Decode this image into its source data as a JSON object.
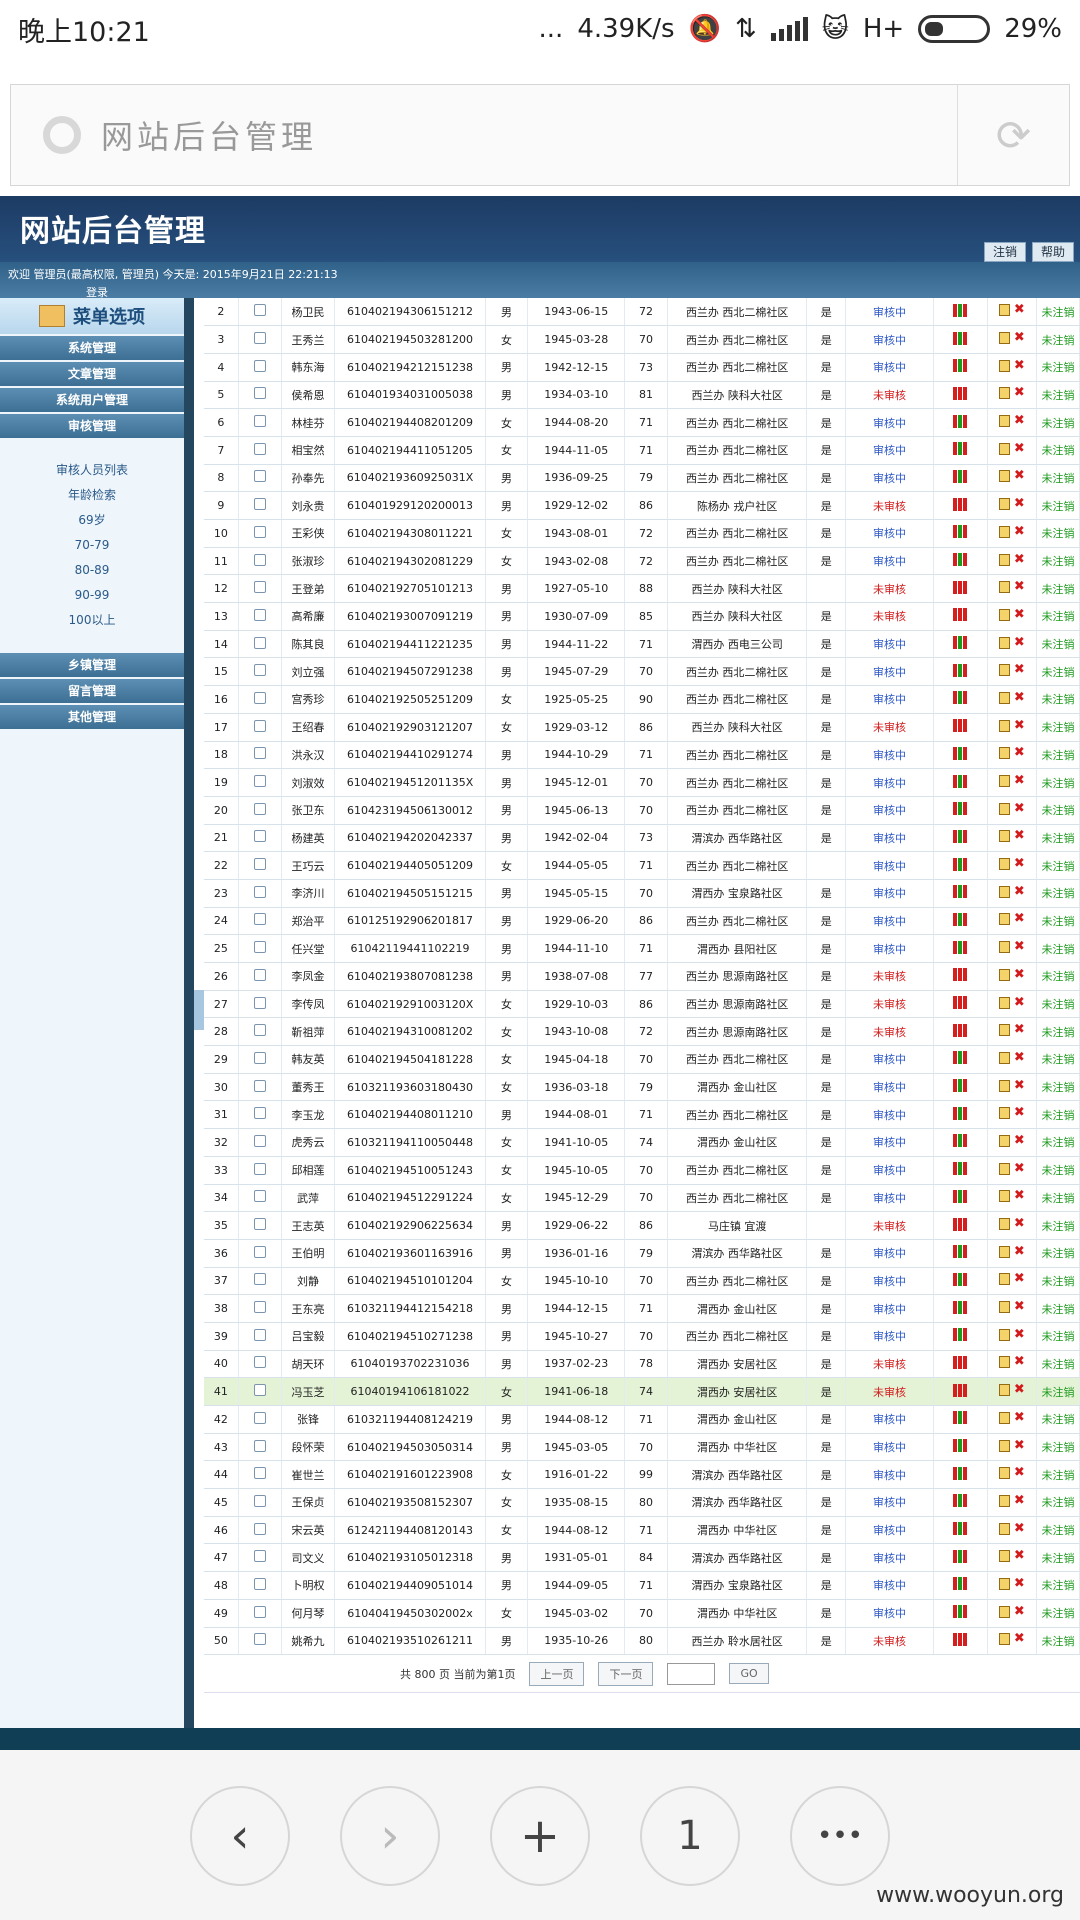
{
  "status_bar": {
    "time": "晚上10:21",
    "dots": "...",
    "speed": "4.39K/s",
    "network": "H+",
    "battery": "29%"
  },
  "browser": {
    "page_title": "网站后台管理"
  },
  "admin": {
    "logo": "网站后台管理",
    "btn_logout": "注销",
    "btn_help": "帮助",
    "welcome": "欢迎 管理员(最高权限, 管理员) 今天是: 2015年9月21日 22:21:13",
    "login_label": "登录"
  },
  "sidebar": {
    "header": "菜单选项",
    "menu": [
      "系统管理",
      "文章管理",
      "系统用户管理",
      "审核管理"
    ],
    "submenu": [
      "审核人员列表",
      "年龄检索",
      "69岁",
      "70-79",
      "80-89",
      "90-99",
      "100以上"
    ],
    "menu2": [
      "乡镇管理",
      "留言管理",
      "其他管理"
    ]
  },
  "table": {
    "rows": [
      {
        "no": "2",
        "name": "杨卫民",
        "id": "610402194306151212",
        "sex": "男",
        "birth": "1943-06-15",
        "age": "72",
        "addr": "西兰办 西北二棉社区",
        "yes": "是",
        "status": "审核中",
        "ok": true,
        "logout": "未注销"
      },
      {
        "no": "3",
        "name": "王秀兰",
        "id": "610402194503281200",
        "sex": "女",
        "birth": "1945-03-28",
        "age": "70",
        "addr": "西兰办 西北二棉社区",
        "yes": "是",
        "status": "审核中",
        "ok": true,
        "logout": "未注销"
      },
      {
        "no": "4",
        "name": "韩东海",
        "id": "610402194212151238",
        "sex": "男",
        "birth": "1942-12-15",
        "age": "73",
        "addr": "西兰办 西北二棉社区",
        "yes": "是",
        "status": "审核中",
        "ok": true,
        "logout": "未注销"
      },
      {
        "no": "5",
        "name": "侯希恩",
        "id": "610401934031005038",
        "sex": "男",
        "birth": "1934-03-10",
        "age": "81",
        "addr": "西兰办 陕科大社区",
        "yes": "是",
        "status": "未审核",
        "ok": false,
        "logout": "未注销"
      },
      {
        "no": "6",
        "name": "林桂芬",
        "id": "610402194408201209",
        "sex": "女",
        "birth": "1944-08-20",
        "age": "71",
        "addr": "西兰办 西北二棉社区",
        "yes": "是",
        "status": "审核中",
        "ok": true,
        "logout": "未注销"
      },
      {
        "no": "7",
        "name": "相宝然",
        "id": "610402194411051205",
        "sex": "女",
        "birth": "1944-11-05",
        "age": "71",
        "addr": "西兰办 西北二棉社区",
        "yes": "是",
        "status": "审核中",
        "ok": true,
        "logout": "未注销"
      },
      {
        "no": "8",
        "name": "孙奉先",
        "id": "61040219360925031X",
        "sex": "男",
        "birth": "1936-09-25",
        "age": "79",
        "addr": "西兰办 西北二棉社区",
        "yes": "是",
        "status": "审核中",
        "ok": true,
        "logout": "未注销"
      },
      {
        "no": "9",
        "name": "刘永贵",
        "id": "610401929120200013",
        "sex": "男",
        "birth": "1929-12-02",
        "age": "86",
        "addr": "陈杨办 戎户社区",
        "yes": "是",
        "status": "未审核",
        "ok": false,
        "logout": "未注销"
      },
      {
        "no": "10",
        "name": "王彩侠",
        "id": "610402194308011221",
        "sex": "女",
        "birth": "1943-08-01",
        "age": "72",
        "addr": "西兰办 西北二棉社区",
        "yes": "是",
        "status": "审核中",
        "ok": true,
        "logout": "未注销"
      },
      {
        "no": "11",
        "name": "张淑珍",
        "id": "610402194302081229",
        "sex": "女",
        "birth": "1943-02-08",
        "age": "72",
        "addr": "西兰办 西北二棉社区",
        "yes": "是",
        "status": "审核中",
        "ok": true,
        "logout": "未注销"
      },
      {
        "no": "12",
        "name": "王登弟",
        "id": "610402192705101213",
        "sex": "男",
        "birth": "1927-05-10",
        "age": "88",
        "addr": "西兰办 陕科大社区",
        "yes": "",
        "status": "未审核",
        "ok": false,
        "logout": "未注销"
      },
      {
        "no": "13",
        "name": "高希廉",
        "id": "610402193007091219",
        "sex": "男",
        "birth": "1930-07-09",
        "age": "85",
        "addr": "西兰办 陕科大社区",
        "yes": "是",
        "status": "未审核",
        "ok": false,
        "logout": "未注销"
      },
      {
        "no": "14",
        "name": "陈其良",
        "id": "610402194411221235",
        "sex": "男",
        "birth": "1944-11-22",
        "age": "71",
        "addr": "渭西办 西电三公司",
        "yes": "是",
        "status": "审核中",
        "ok": true,
        "logout": "未注销"
      },
      {
        "no": "15",
        "name": "刘立强",
        "id": "610402194507291238",
        "sex": "男",
        "birth": "1945-07-29",
        "age": "70",
        "addr": "西兰办 西北二棉社区",
        "yes": "是",
        "status": "审核中",
        "ok": true,
        "logout": "未注销"
      },
      {
        "no": "16",
        "name": "宫秀珍",
        "id": "610402192505251209",
        "sex": "女",
        "birth": "1925-05-25",
        "age": "90",
        "addr": "西兰办 西北二棉社区",
        "yes": "是",
        "status": "审核中",
        "ok": true,
        "logout": "未注销"
      },
      {
        "no": "17",
        "name": "王绍春",
        "id": "610402192903121207",
        "sex": "女",
        "birth": "1929-03-12",
        "age": "86",
        "addr": "西兰办 陕科大社区",
        "yes": "是",
        "status": "未审核",
        "ok": false,
        "logout": "未注销"
      },
      {
        "no": "18",
        "name": "洪永汉",
        "id": "610402194410291274",
        "sex": "男",
        "birth": "1944-10-29",
        "age": "71",
        "addr": "西兰办 西北二棉社区",
        "yes": "是",
        "status": "审核中",
        "ok": true,
        "logout": "未注销"
      },
      {
        "no": "19",
        "name": "刘淑效",
        "id": "61040219451201135X",
        "sex": "男",
        "birth": "1945-12-01",
        "age": "70",
        "addr": "西兰办 西北二棉社区",
        "yes": "是",
        "status": "审核中",
        "ok": true,
        "logout": "未注销"
      },
      {
        "no": "20",
        "name": "张卫东",
        "id": "610423194506130012",
        "sex": "男",
        "birth": "1945-06-13",
        "age": "70",
        "addr": "西兰办 西北二棉社区",
        "yes": "是",
        "status": "审核中",
        "ok": true,
        "logout": "未注销"
      },
      {
        "no": "21",
        "name": "杨建英",
        "id": "610402194202042337",
        "sex": "男",
        "birth": "1942-02-04",
        "age": "73",
        "addr": "渭滨办 西华路社区",
        "yes": "是",
        "status": "审核中",
        "ok": true,
        "logout": "未注销"
      },
      {
        "no": "22",
        "name": "王巧云",
        "id": "610402194405051209",
        "sex": "女",
        "birth": "1944-05-05",
        "age": "71",
        "addr": "西兰办 西北二棉社区",
        "yes": "",
        "status": "审核中",
        "ok": true,
        "logout": "未注销"
      },
      {
        "no": "23",
        "name": "李济川",
        "id": "610402194505151215",
        "sex": "男",
        "birth": "1945-05-15",
        "age": "70",
        "addr": "渭西办 宝泉路社区",
        "yes": "是",
        "status": "审核中",
        "ok": true,
        "logout": "未注销"
      },
      {
        "no": "24",
        "name": "郑治平",
        "id": "610125192906201817",
        "sex": "男",
        "birth": "1929-06-20",
        "age": "86",
        "addr": "西兰办 西北二棉社区",
        "yes": "是",
        "status": "审核中",
        "ok": true,
        "logout": "未注销"
      },
      {
        "no": "25",
        "name": "任兴堂",
        "id": "6104211944110221​9",
        "sex": "男",
        "birth": "1944-11-10",
        "age": "71",
        "addr": "渭西办 县阳社区",
        "yes": "是",
        "status": "审核中",
        "ok": true,
        "logout": "未注销"
      },
      {
        "no": "26",
        "name": "李凤金",
        "id": "610402193807081238",
        "sex": "男",
        "birth": "1938-07-08",
        "age": "77",
        "addr": "西兰办 思源南路社区",
        "yes": "是",
        "status": "未审核",
        "ok": false,
        "logout": "未注销"
      },
      {
        "no": "27",
        "name": "李传凤",
        "id": "61040219291003120X",
        "sex": "女",
        "birth": "1929-10-03",
        "age": "86",
        "addr": "西兰办 思源南路社区",
        "yes": "是",
        "status": "未审核",
        "ok": false,
        "logout": "未注销"
      },
      {
        "no": "28",
        "name": "靳祖萍",
        "id": "610402194310081202",
        "sex": "女",
        "birth": "1943-10-08",
        "age": "72",
        "addr": "西兰办 思源南路社区",
        "yes": "是",
        "status": "未审核",
        "ok": false,
        "logout": "未注销"
      },
      {
        "no": "29",
        "name": "韩友英",
        "id": "610402194504181228",
        "sex": "女",
        "birth": "1945-04-18",
        "age": "70",
        "addr": "西兰办 西北二棉社区",
        "yes": "是",
        "status": "审核中",
        "ok": true,
        "logout": "未注销"
      },
      {
        "no": "30",
        "name": "董秀王",
        "id": "610321193603180430",
        "sex": "女",
        "birth": "1936-03-18",
        "age": "79",
        "addr": "渭西办 金山社区",
        "yes": "是",
        "status": "审核中",
        "ok": true,
        "logout": "未注销"
      },
      {
        "no": "31",
        "name": "李玉龙",
        "id": "610402194408011210",
        "sex": "男",
        "birth": "1944-08-01",
        "age": "71",
        "addr": "西兰办 西北二棉社区",
        "yes": "是",
        "status": "审核中",
        "ok": true,
        "logout": "未注销"
      },
      {
        "no": "32",
        "name": "虎秀云",
        "id": "610321194110050448",
        "sex": "女",
        "birth": "1941-10-05",
        "age": "74",
        "addr": "渭西办 金山社区",
        "yes": "是",
        "status": "审核中",
        "ok": true,
        "logout": "未注销"
      },
      {
        "no": "33",
        "name": "邱相莲",
        "id": "610402194510051243",
        "sex": "女",
        "birth": "1945-10-05",
        "age": "70",
        "addr": "西兰办 西北二棉社区",
        "yes": "是",
        "status": "审核中",
        "ok": true,
        "logout": "未注销"
      },
      {
        "no": "34",
        "name": "武萍",
        "id": "610402194512291224",
        "sex": "女",
        "birth": "1945-12-29",
        "age": "70",
        "addr": "西兰办 西北二棉社区",
        "yes": "是",
        "status": "审核中",
        "ok": true,
        "logout": "未注销"
      },
      {
        "no": "35",
        "name": "王志英",
        "id": "610402192906225634",
        "sex": "男",
        "birth": "1929-06-22",
        "age": "86",
        "addr": "马庄镇 宜渡",
        "yes": "",
        "status": "未审核",
        "ok": false,
        "logout": "未注销"
      },
      {
        "no": "36",
        "name": "王伯明",
        "id": "610402193601163916",
        "sex": "男",
        "birth": "1936-01-16",
        "age": "79",
        "addr": "渭滨办 西华路社区",
        "yes": "是",
        "status": "审核中",
        "ok": true,
        "logout": "未注销"
      },
      {
        "no": "37",
        "name": "刘静",
        "id": "610402194510101204",
        "sex": "女",
        "birth": "1945-10-10",
        "age": "70",
        "addr": "西兰办 西北二棉社区",
        "yes": "是",
        "status": "审核中",
        "ok": true,
        "logout": "未注销"
      },
      {
        "no": "38",
        "name": "王东亮",
        "id": "610321194412154218",
        "sex": "男",
        "birth": "1944-12-15",
        "age": "71",
        "addr": "渭西办 金山社区",
        "yes": "是",
        "status": "审核中",
        "ok": true,
        "logout": "未注销"
      },
      {
        "no": "39",
        "name": "吕宝毅",
        "id": "610402194510271238",
        "sex": "男",
        "birth": "1945-10-27",
        "age": "70",
        "addr": "西兰办 西北二棉社区",
        "yes": "是",
        "status": "审核中",
        "ok": true,
        "logout": "未注销"
      },
      {
        "no": "40",
        "name": "胡天环",
        "id": "610401937022310​36",
        "sex": "男",
        "birth": "1937-02-23",
        "age": "78",
        "addr": "渭西办 安居社区",
        "yes": "是",
        "status": "未审核",
        "ok": false,
        "logout": "未注销"
      },
      {
        "no": "41",
        "name": "冯玉芝",
        "id": "610401941061810​22",
        "sex": "女",
        "birth": "1941-06-18",
        "age": "74",
        "addr": "渭西办 安居社区",
        "yes": "是",
        "status": "未审核",
        "ok": false,
        "logout": "未注销",
        "hl": true
      },
      {
        "no": "42",
        "name": "张锋",
        "id": "610321194408124219",
        "sex": "男",
        "birth": "1944-08-12",
        "age": "71",
        "addr": "渭西办 金山社区",
        "yes": "是",
        "status": "审核中",
        "ok": true,
        "logout": "未注销"
      },
      {
        "no": "43",
        "name": "段怀荣",
        "id": "610402194503050314",
        "sex": "男",
        "birth": "1945-03-05",
        "age": "70",
        "addr": "渭西办 中华社区",
        "yes": "是",
        "status": "审核中",
        "ok": true,
        "logout": "未注销"
      },
      {
        "no": "44",
        "name": "崔世兰",
        "id": "610402191601223908",
        "sex": "女",
        "birth": "1916-01-22",
        "age": "99",
        "addr": "渭滨办 西华路社区",
        "yes": "是",
        "status": "审核中",
        "ok": true,
        "logout": "未注销"
      },
      {
        "no": "45",
        "name": "王保贞",
        "id": "610402193508152307",
        "sex": "女",
        "birth": "1935-08-15",
        "age": "80",
        "addr": "渭滨办 西华路社区",
        "yes": "是",
        "status": "审核中",
        "ok": true,
        "logout": "未注销"
      },
      {
        "no": "46",
        "name": "宋云英",
        "id": "612421194408120143",
        "sex": "女",
        "birth": "1944-08-12",
        "age": "71",
        "addr": "渭西办 中华社区",
        "yes": "是",
        "status": "审核中",
        "ok": true,
        "logout": "未注销"
      },
      {
        "no": "47",
        "name": "司文义",
        "id": "610402193105012318",
        "sex": "男",
        "birth": "1931-05-01",
        "age": "84",
        "addr": "渭滨办 西华路社区",
        "yes": "是",
        "status": "审核中",
        "ok": true,
        "logout": "未注销"
      },
      {
        "no": "48",
        "name": "卜明权",
        "id": "610402194409051014",
        "sex": "男",
        "birth": "1944-09-05",
        "age": "71",
        "addr": "渭西办 宝泉路社区",
        "yes": "是",
        "status": "审核中",
        "ok": true,
        "logout": "未注销"
      },
      {
        "no": "49",
        "name": "何月琴",
        "id": "61040419450302002x",
        "sex": "女",
        "birth": "1945-03-02",
        "age": "70",
        "addr": "渭西办 中华社区",
        "yes": "是",
        "status": "审核中",
        "ok": true,
        "logout": "未注销"
      },
      {
        "no": "50",
        "name": "姚希九",
        "id": "610402193510261211",
        "sex": "男",
        "birth": "1935-10-26",
        "age": "80",
        "addr": "西兰办 聆水居社区",
        "yes": "是",
        "status": "未审核",
        "ok": false,
        "logout": "未注销"
      }
    ]
  },
  "pager": {
    "info": "共 800 页 当前为第1页",
    "prev": "上一页",
    "next": "下一页",
    "go": "GO"
  },
  "nav": {
    "back": "‹",
    "forward": "›",
    "add": "+",
    "tabs": "1",
    "more": "•••"
  },
  "watermark": "www.wooyun.org",
  "colors": {
    "header_blue": "#1c3b63",
    "status_ok": "#2d58c8",
    "status_no": "#d31b1b",
    "logout_green": "#1d9a1d",
    "highlight_row": "#e4f2d6"
  }
}
